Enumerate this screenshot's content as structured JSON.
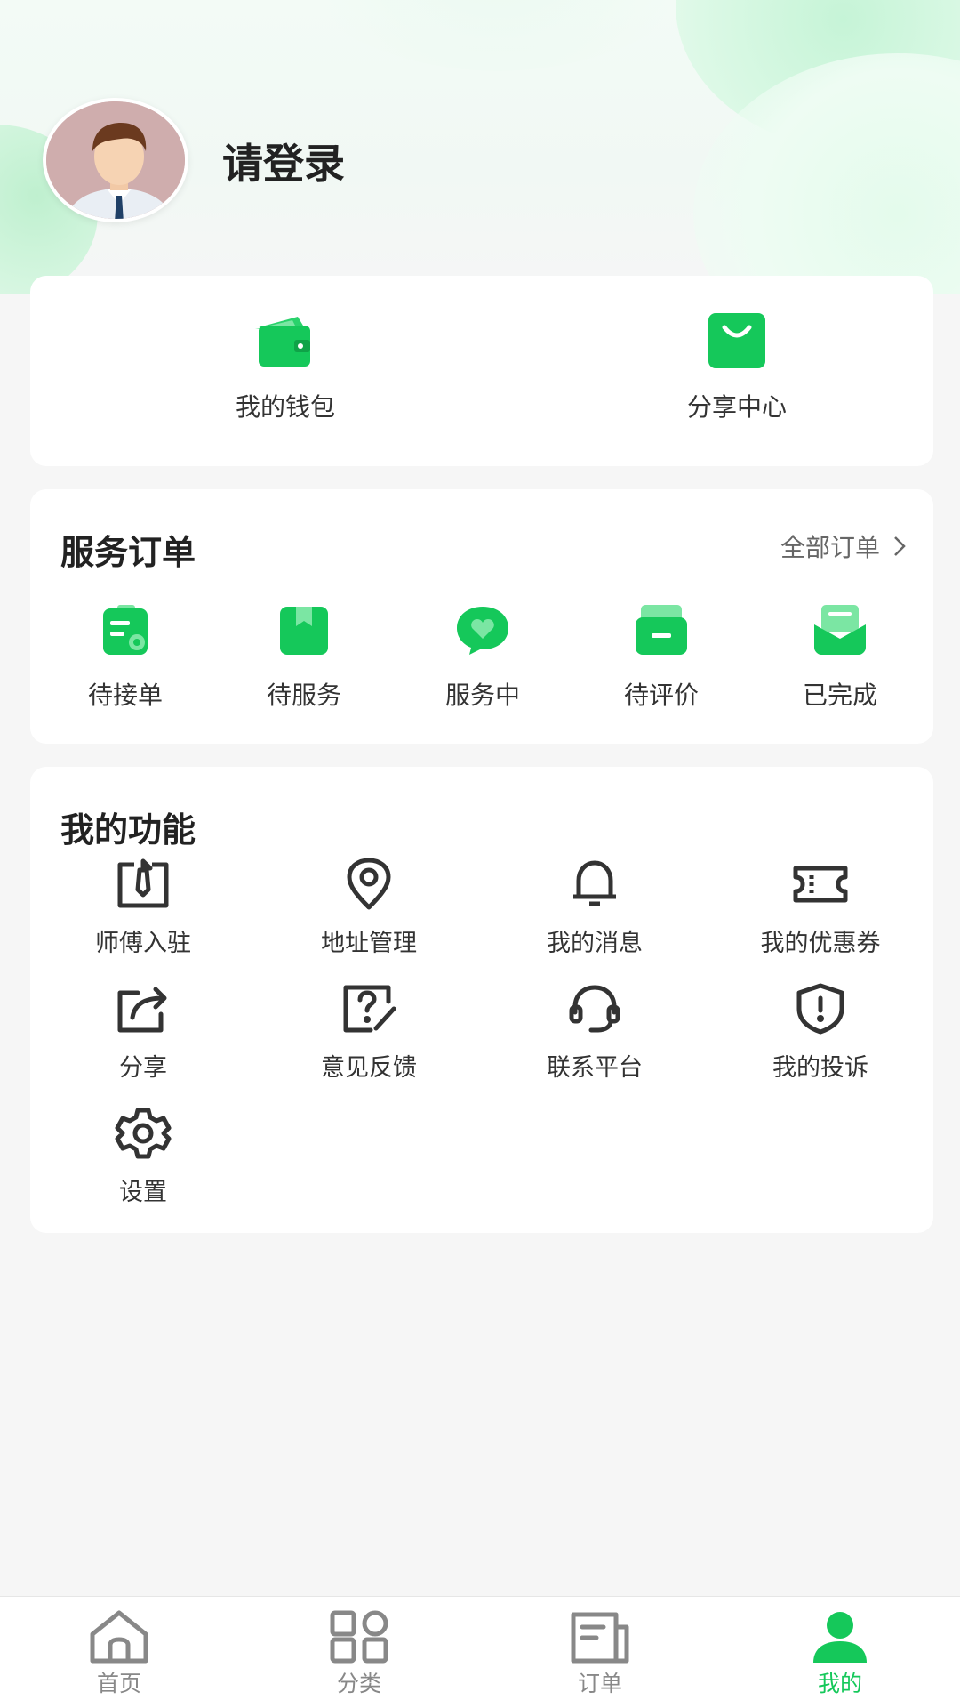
{
  "profile": {
    "login_prompt": "请登录"
  },
  "wallet": {
    "items": [
      {
        "label": "我的钱包",
        "icon": "wallet-icon"
      },
      {
        "label": "分享中心",
        "icon": "shopping-bag-icon"
      }
    ]
  },
  "orders": {
    "title": "服务订单",
    "all_label": "全部订单",
    "items": [
      {
        "label": "待接单",
        "icon": "clipboard-icon"
      },
      {
        "label": "待服务",
        "icon": "bookmark-icon"
      },
      {
        "label": "服务中",
        "icon": "chat-heart-icon"
      },
      {
        "label": "待评价",
        "icon": "inbox-icon"
      },
      {
        "label": "已完成",
        "icon": "envelope-open-icon"
      }
    ]
  },
  "features": {
    "title": "我的功能",
    "items": [
      {
        "label": "师傅入驻",
        "icon": "tie-badge-icon"
      },
      {
        "label": "地址管理",
        "icon": "location-pin-icon"
      },
      {
        "label": "我的消息",
        "icon": "bell-icon"
      },
      {
        "label": "我的优惠券",
        "icon": "ticket-icon"
      },
      {
        "label": "分享",
        "icon": "share-icon"
      },
      {
        "label": "意见反馈",
        "icon": "feedback-icon"
      },
      {
        "label": "联系平台",
        "icon": "headset-icon"
      },
      {
        "label": "我的投诉",
        "icon": "shield-alert-icon"
      },
      {
        "label": "设置",
        "icon": "gear-icon"
      }
    ]
  },
  "tabbar": {
    "items": [
      {
        "label": "首页",
        "icon": "home-icon",
        "active": false
      },
      {
        "label": "分类",
        "icon": "category-grid-icon",
        "active": false
      },
      {
        "label": "订单",
        "icon": "order-list-icon",
        "active": false
      },
      {
        "label": "我的",
        "icon": "user-icon",
        "active": true
      }
    ]
  },
  "colors": {
    "accent": "#15c85a",
    "text": "#222222",
    "muted": "#888888",
    "icon_dark": "#333333"
  }
}
